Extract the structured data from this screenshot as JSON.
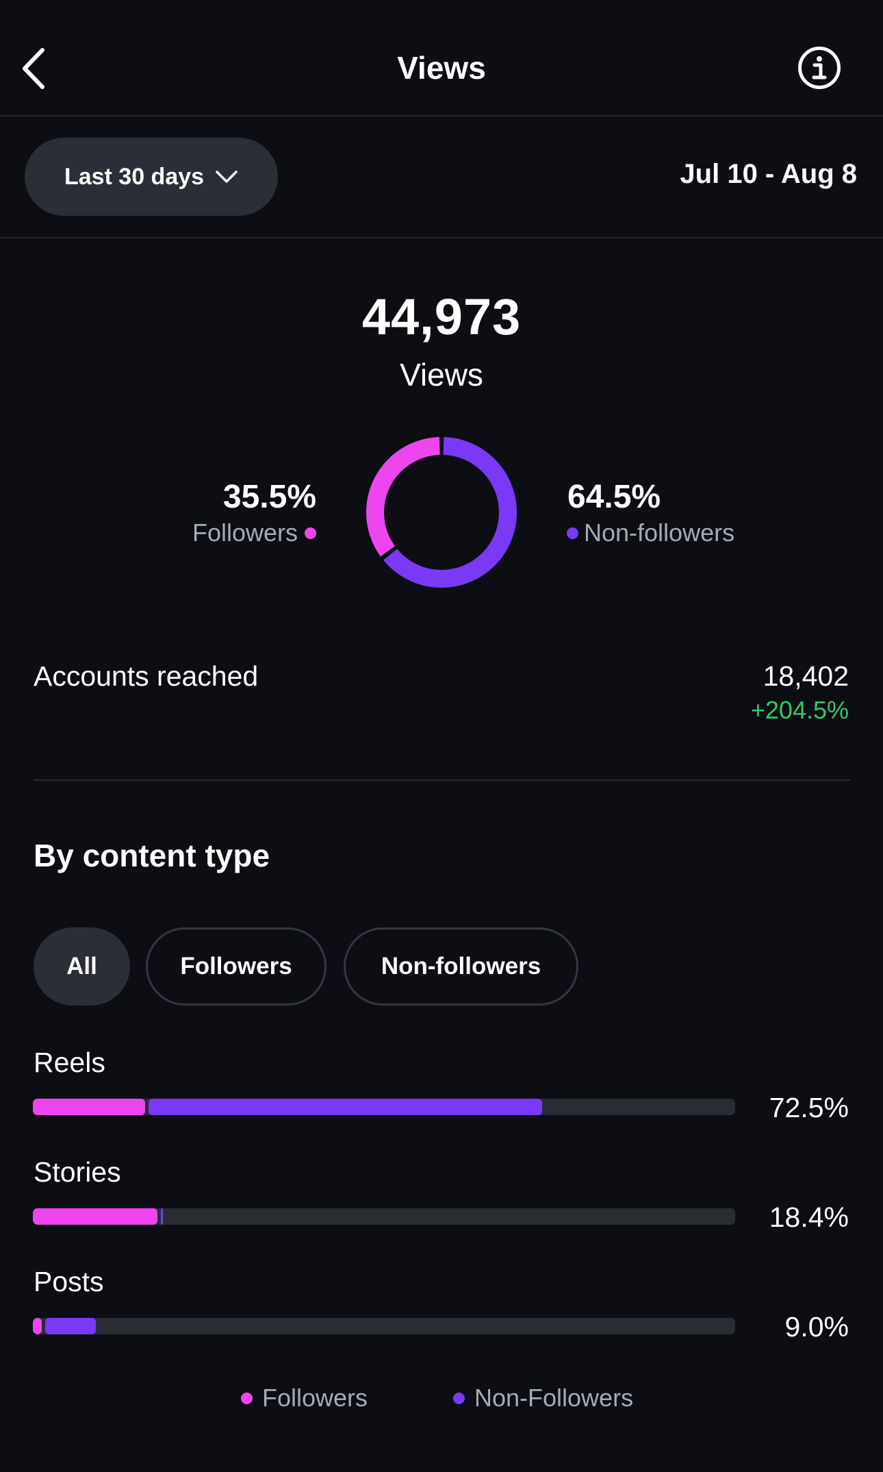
{
  "header": {
    "title": "Views",
    "back_icon": "chevron-left-icon",
    "info_icon": "info-icon"
  },
  "filter": {
    "range_label": "Last 30 days",
    "dropdown_icon": "chevron-down-icon",
    "date_range": "Jul 10 - Aug 8"
  },
  "summary": {
    "total": "44,973",
    "total_label": "Views",
    "followers_pct": "35.5%",
    "followers_label": "Followers",
    "nonfollowers_pct": "64.5%",
    "nonfollowers_label": "Non-followers",
    "followers_share": 0.355,
    "nonfollowers_share": 0.645
  },
  "accounts_reached": {
    "label": "Accounts reached",
    "value": "18,402",
    "change": "+204.5%"
  },
  "content_type": {
    "title": "By content type",
    "filters": [
      "All",
      "Followers",
      "Non-followers"
    ],
    "selected_filter": "All",
    "rows": [
      {
        "label": "Reels",
        "pct": "72.5%",
        "followers_share": 16.2,
        "nonfollowers_share": 56.3
      },
      {
        "label": "Stories",
        "pct": "18.4%",
        "followers_share": 17.9,
        "nonfollowers_share": 0.5
      },
      {
        "label": "Posts",
        "pct": "9.0%",
        "followers_share": 1.5,
        "nonfollowers_share": 7.5
      }
    ],
    "legend": [
      "Followers",
      "Non-Followers"
    ]
  },
  "colors": {
    "followers": "#ee46ee",
    "nonfollowers": "#7a39f6",
    "background": "#0c0e13",
    "positive": "#2fca68"
  }
}
